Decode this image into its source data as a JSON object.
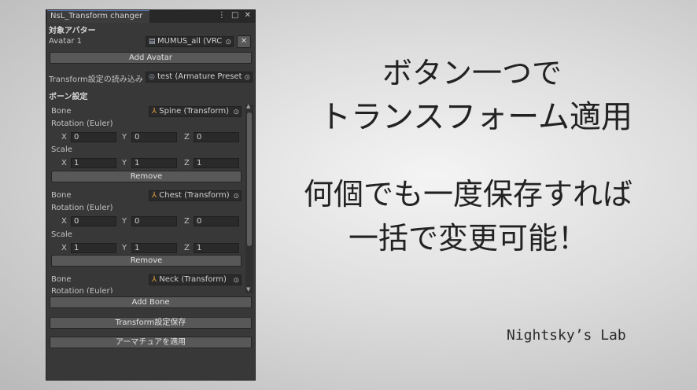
{
  "window": {
    "title": "NsL_Transform changer",
    "controls": "⋮ □ ✕"
  },
  "avatar_section": {
    "header": "対象アバター",
    "label": "Avatar 1",
    "field": "MUMUS_all (VRC",
    "field_icon": "file-icon",
    "clear": "✕",
    "add_avatar": "Add Avatar"
  },
  "load_section": {
    "label": "Transform設定の読み込み",
    "field": "test (Armature Preset"
  },
  "bone_section": {
    "header": "ボーン設定",
    "bone_label": "Bone",
    "rotation_label": "Rotation (Euler)",
    "scale_label": "Scale",
    "remove": "Remove",
    "axis_x": "X",
    "axis_y": "Y",
    "axis_z": "Z",
    "bones": [
      {
        "name": "Spine (Transform)",
        "rot": [
          "0",
          "0",
          "0"
        ],
        "scale": [
          "1",
          "1",
          "1"
        ]
      },
      {
        "name": "Chest (Transform)",
        "rot": [
          "0",
          "0",
          "0"
        ],
        "scale": [
          "1",
          "1",
          "1"
        ]
      },
      {
        "name": "Neck (Transform)"
      }
    ]
  },
  "buttons": {
    "add_bone": "Add Bone",
    "save": "Transform設定保存",
    "apply": "アーマチュアを適用"
  },
  "headline": {
    "line1": "ボタン一つで",
    "line2": "トランスフォーム適用",
    "line3": "何個でも一度保存すれば",
    "line4": "一括で変更可能！"
  },
  "credit": "Nightsky’s Lab"
}
